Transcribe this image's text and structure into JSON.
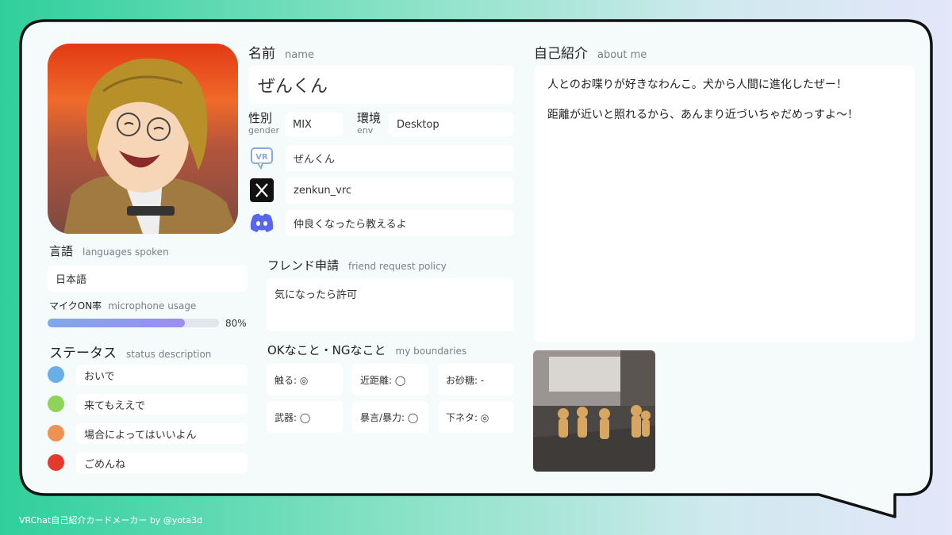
{
  "left": {
    "languages": {
      "title": "言語",
      "subtitle": "languages spoken",
      "value": "日本語"
    },
    "mic": {
      "title": "マイクON率",
      "subtitle": "microphone usage",
      "percent_label": "80%",
      "fraction": 0.8
    },
    "status": {
      "title": "ステータス",
      "subtitle": "status description",
      "items": [
        {
          "color": "#6aaee8",
          "label": "おいで"
        },
        {
          "color": "#8ed35a",
          "label": "来てもええで"
        },
        {
          "color": "#ef9150",
          "label": "場合によってはいいよん"
        },
        {
          "color": "#e6392e",
          "label": "ごめんね"
        }
      ]
    }
  },
  "profile": {
    "name_title": "名前",
    "name_subtitle": "name",
    "name_value": "ぜんくん",
    "gender_title": "性別",
    "gender_subtitle": "gender",
    "gender_value": "MIX",
    "env_title": "環境",
    "env_subtitle": "env",
    "env_value": "Desktop",
    "socials": [
      {
        "icon": "vrchat-icon",
        "value": "ぜんくん"
      },
      {
        "icon": "x-icon",
        "value": "zenkun_vrc"
      },
      {
        "icon": "discord-icon",
        "value": "仲良くなったら教えるよ"
      }
    ],
    "friend": {
      "title": "フレンド申請",
      "subtitle": "friend request policy",
      "value": "気になったら許可"
    },
    "boundaries": {
      "title": "OKなこと・NGなこと",
      "subtitle": "my boundaries",
      "items": [
        "触る: ◎",
        "近距離: ◯",
        "お砂糖: -",
        "武器: ◯",
        "暴言/暴力: ◯",
        "下ネタ: ◎"
      ]
    }
  },
  "about": {
    "title": "自己紹介",
    "subtitle": "about me",
    "line1": "人とのお喋りが好きなわんこ。犬から人間に進化したぜー！",
    "line2": "距離が近いと照れるから、あんまり近づいちゃだめっすよ〜！"
  },
  "footer": "VRChat自己紹介カードメーカー by @yota3d",
  "colors": {
    "accent_start": "#7fa7ee",
    "accent_end": "#9d8cf1",
    "card_bg": "#f4fafa",
    "border": "#111111"
  }
}
